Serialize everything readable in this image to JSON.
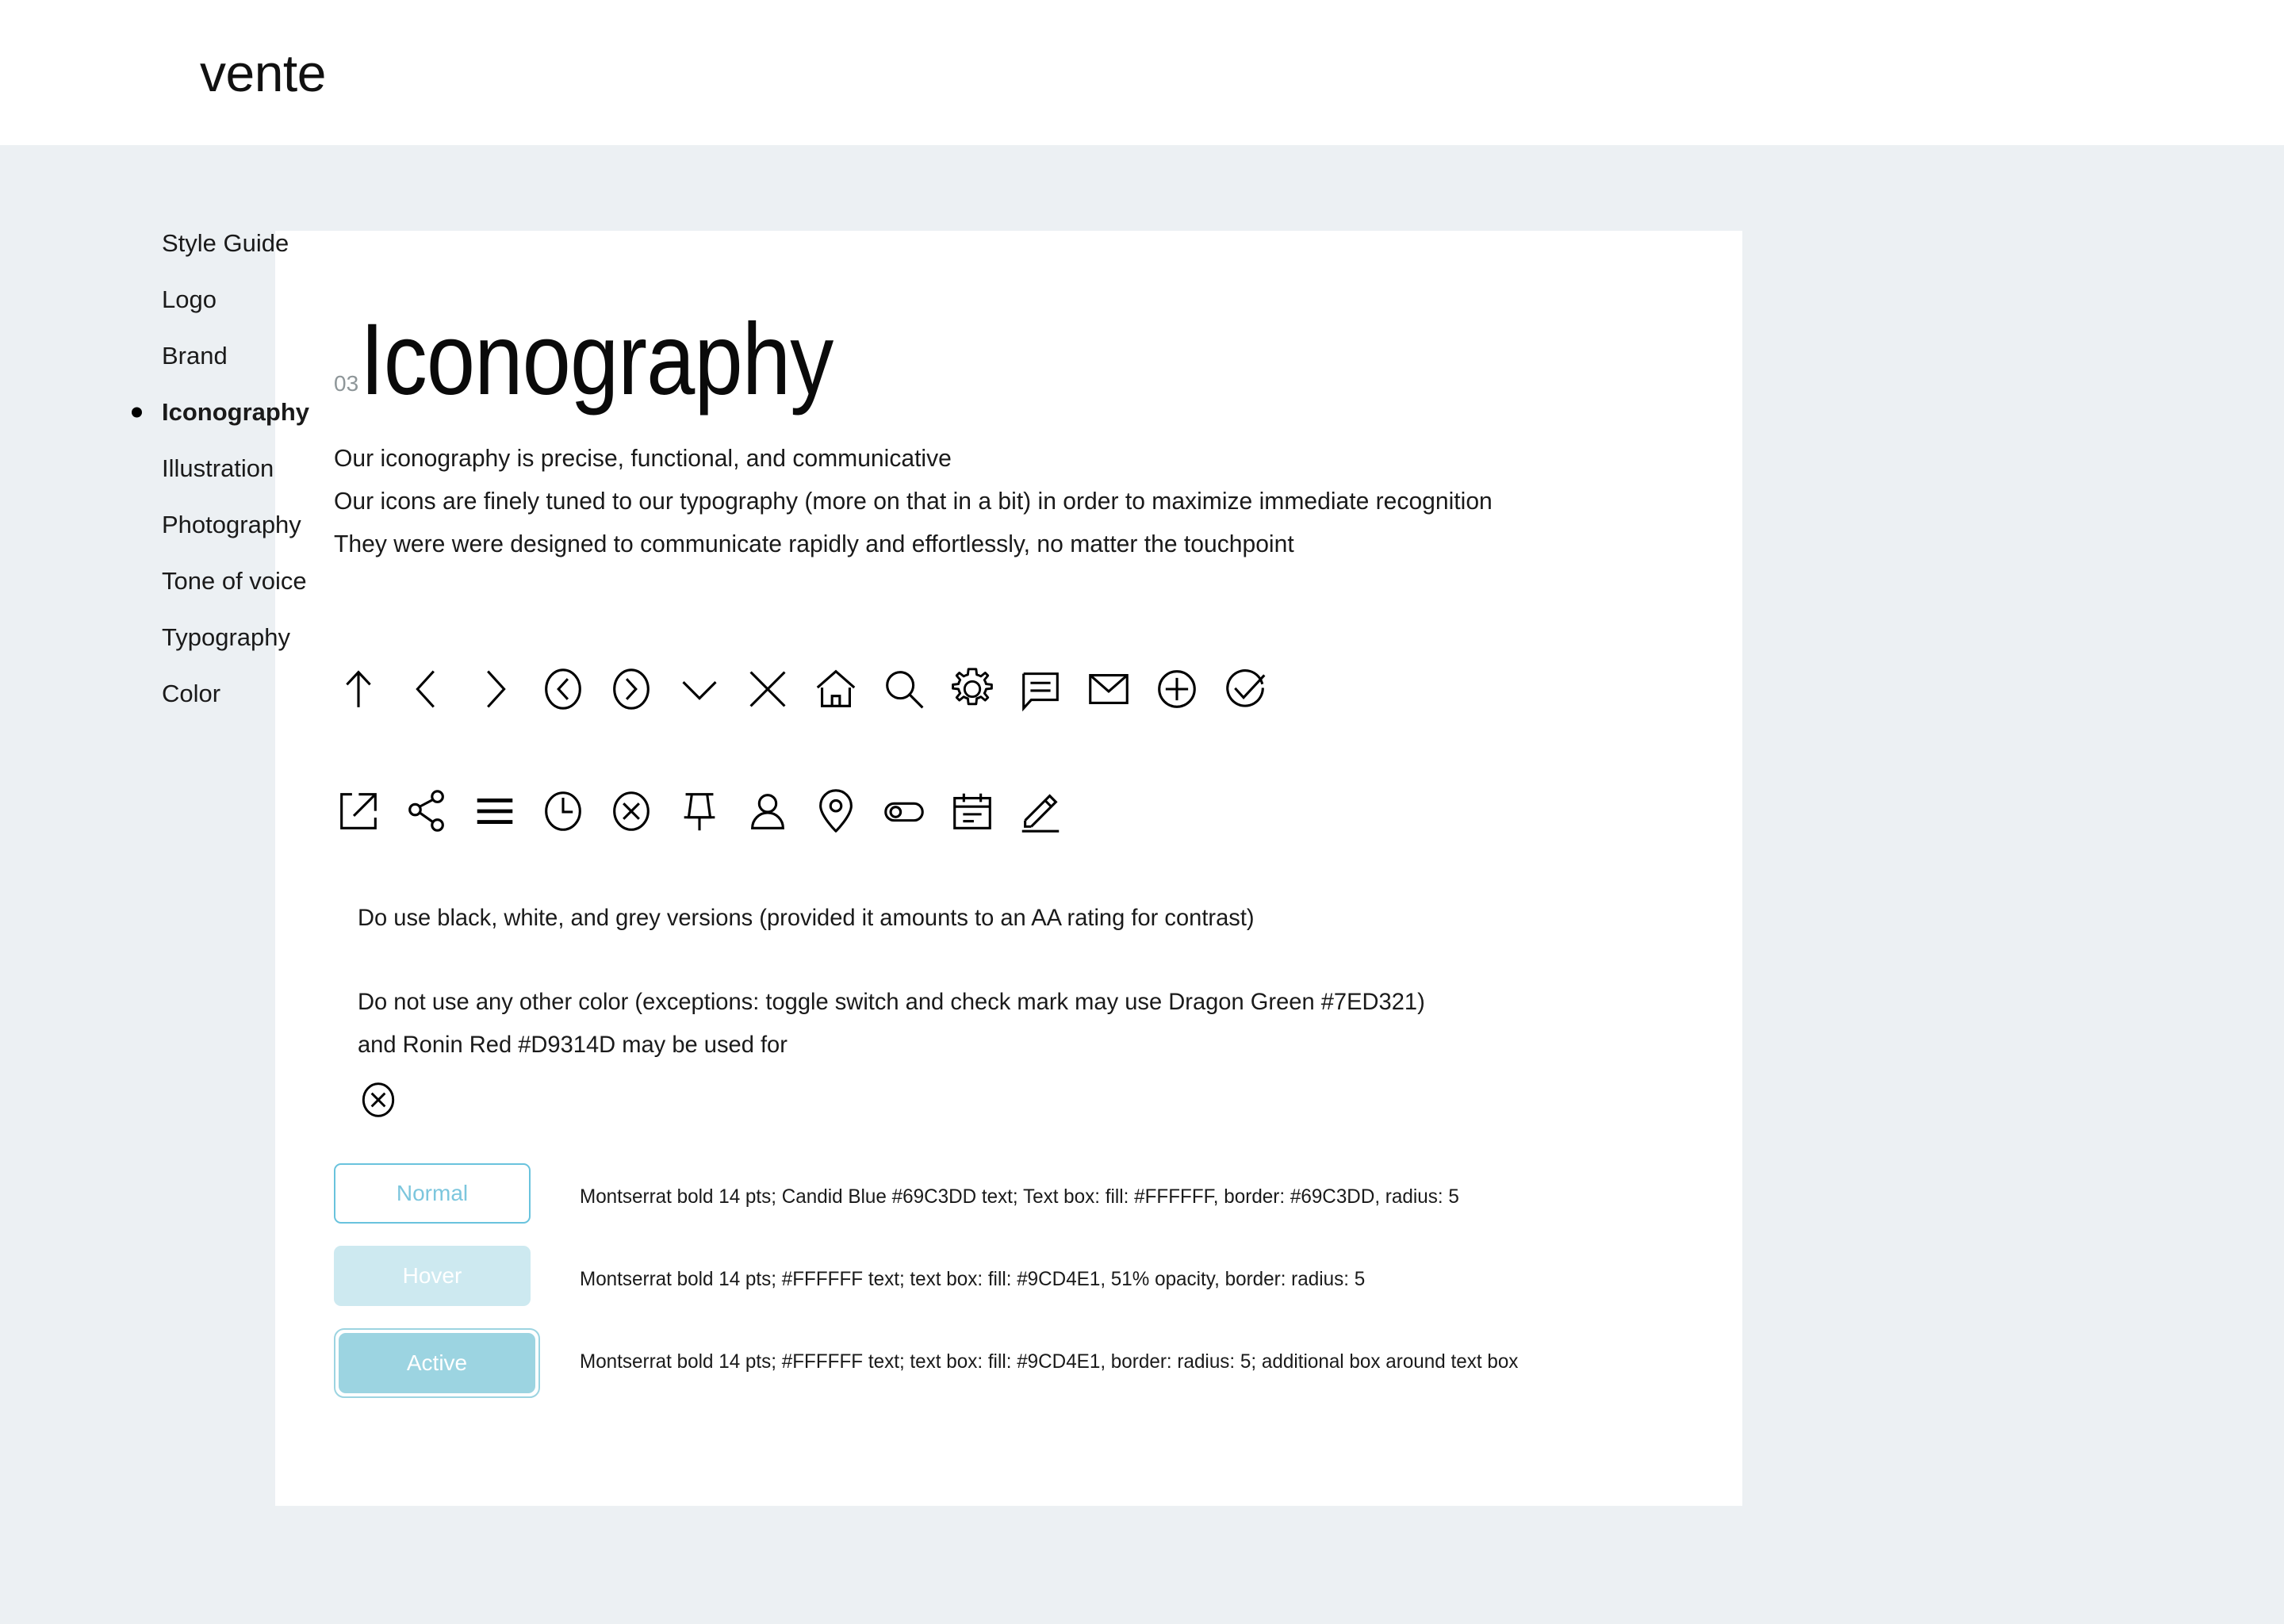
{
  "header": {
    "logo": "vente"
  },
  "sidebar": {
    "items": [
      {
        "label": "Style Guide",
        "active": false
      },
      {
        "label": "Logo",
        "active": false
      },
      {
        "label": "Brand",
        "active": false
      },
      {
        "label": "Iconography",
        "active": true
      },
      {
        "label": "Illustration",
        "active": false
      },
      {
        "label": "Photography",
        "active": false
      },
      {
        "label": "Tone of voice",
        "active": false
      },
      {
        "label": "Typography",
        "active": false
      },
      {
        "label": "Color",
        "active": false
      }
    ]
  },
  "main": {
    "section_number": "03",
    "title": "Iconography",
    "intro_lines": [
      "Our iconography is precise, functional, and communicative",
      "Our icons are finely tuned to our typography (more on that in a bit) in order to maximize immediate recognition",
      "They were were designed to communicate rapidly and effortlessly, no matter the touchpoint"
    ],
    "icon_rows": [
      [
        "arrow-up-icon",
        "chevron-left-icon",
        "chevron-right-icon",
        "chevron-left-circle-icon",
        "chevron-right-circle-icon",
        "chevron-down-icon",
        "close-icon",
        "home-icon",
        "search-icon",
        "gear-icon",
        "chat-icon",
        "mail-icon",
        "plus-circle-icon",
        "check-circle-icon"
      ],
      [
        "external-link-icon",
        "share-icon",
        "menu-icon",
        "clock-icon",
        "x-circle-icon",
        "pin-icon",
        "user-icon",
        "map-pin-icon",
        "toggle-switch-icon",
        "calendar-icon",
        "pencil-icon"
      ]
    ],
    "guidelines": {
      "do": "Do use black, white, and grey versions (provided it amounts to an AA rating for contrast)",
      "dont_line1": "Do not use any other color (exceptions: toggle switch and check mark may use Dragon Green #7ED321)",
      "dont_line2": "and Ronin Red #D9314D may be used for",
      "dont_icon": "x-circle-icon"
    },
    "button_specs": [
      {
        "state": "Normal",
        "spec": "Montserrat bold 14 pts; Candid Blue #69C3DD text; Text box: fill: #FFFFFF, border: #69C3DD, radius: 5"
      },
      {
        "state": "Hover",
        "spec": "Montserrat bold 14 pts; #FFFFFF text; text box: fill: #9CD4E1, 51% opacity, border: radius: 5"
      },
      {
        "state": "Active",
        "spec": "Montserrat bold 14 pts; #FFFFFF text; text box: fill: #9CD4E1, border: radius: 5; additional box around text box"
      }
    ]
  },
  "colors": {
    "page_background": "#ECF0F3",
    "card_background": "#FFFFFF",
    "text": "#1A1A1A",
    "section_number": "#8E9699",
    "candid_blue": "#69C3DD",
    "hover_fill": "#9CD4E1",
    "dragon_green": "#7ED321",
    "ronin_red": "#D9314D"
  }
}
